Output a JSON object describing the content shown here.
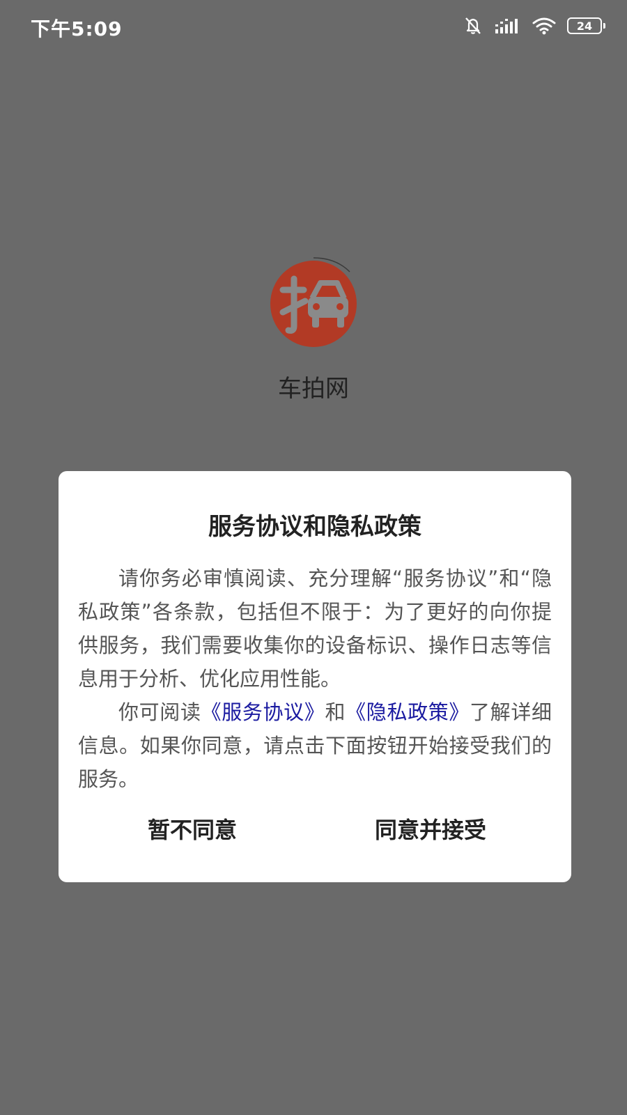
{
  "status_bar": {
    "time": "下午5:09",
    "battery_level": "24",
    "icons": [
      "mute-icon",
      "signal-icon",
      "wifi-icon",
      "battery-icon"
    ]
  },
  "app": {
    "name": "车拍网",
    "logo_char": "拍",
    "logo_color": "#b23a25"
  },
  "dialog": {
    "title": "服务协议和隐私政策",
    "paragraph1": "请你务必审慎阅读、充分理解“服务协议”和“隐私政策”各条款，包括但不限于：为了更好的向你提供服务，我们需要收集你的设备标识、操作日志等信息用于分析、优化应用性能。",
    "paragraph2_prefix": "你可阅读",
    "link_service": "《服务协议》",
    "paragraph2_and": "和",
    "link_privacy": "《隐私政策》",
    "paragraph2_suffix": "了解详细信息。如果你同意，请点击下面按钮开始接受我们的服务。",
    "decline_label": "暂不同意",
    "agree_label": "同意并接受",
    "link_color": "#1a1aa0"
  }
}
